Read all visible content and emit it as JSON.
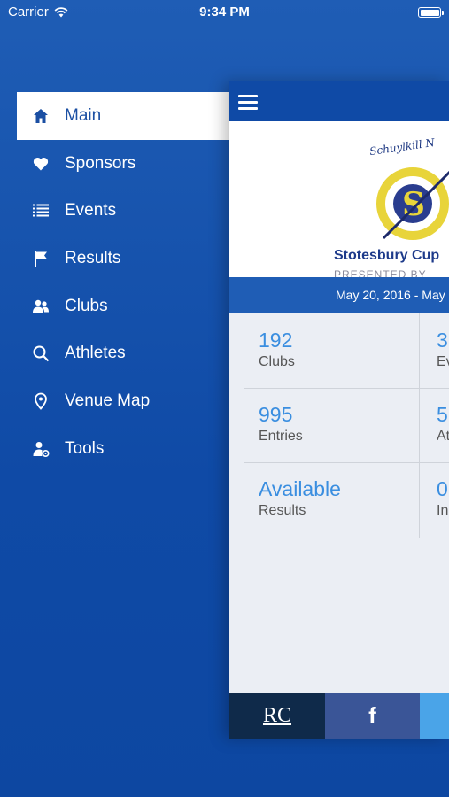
{
  "status_bar": {
    "carrier": "Carrier",
    "time": "9:34 PM"
  },
  "menu": {
    "items": [
      {
        "label": "Main",
        "icon": "home-icon",
        "active": true
      },
      {
        "label": "Sponsors",
        "icon": "heart-icon"
      },
      {
        "label": "Events",
        "icon": "list-icon"
      },
      {
        "label": "Results",
        "icon": "flag-icon"
      },
      {
        "label": "Clubs",
        "icon": "group-icon"
      },
      {
        "label": "Athletes",
        "icon": "search-icon"
      },
      {
        "label": "Venue Map",
        "icon": "map-pin-icon"
      },
      {
        "label": "Tools",
        "icon": "tools-icon"
      }
    ]
  },
  "banner": {
    "top_text": "Schuylkill N",
    "title": "Stotesbury Cup",
    "subtitle": "PRESENTED BY"
  },
  "date_range": "May 20, 2016 - May",
  "stats": [
    {
      "value": "192",
      "label": "Clubs"
    },
    {
      "value": "3",
      "label": "Ev"
    },
    {
      "value": "995",
      "label": "Entries"
    },
    {
      "value": "5",
      "label": "At"
    },
    {
      "value": "Available",
      "label": "Results"
    },
    {
      "value": "0",
      "label": "In"
    }
  ],
  "social": {
    "rc_label": "RC",
    "facebook_label": "f"
  },
  "colors": {
    "brand_blue": "#0f4aa6",
    "accent_blue": "#3a8ee0",
    "panel_bg": "#ebeef4"
  }
}
